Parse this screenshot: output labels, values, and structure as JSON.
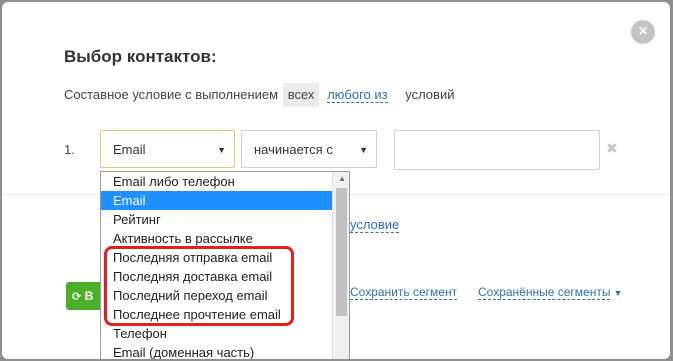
{
  "dialog": {
    "title": "Выбор контактов:",
    "close_icon": "×",
    "condition": {
      "prefix": "Составное условие с выполнением",
      "option_all": "всех",
      "option_any": "любого из",
      "suffix": "условий"
    },
    "row": {
      "number": "1.",
      "field_value": "Email",
      "operator_value": "начинается с",
      "value_text": ""
    },
    "add_condition": "условие",
    "buttons": {
      "green_label": "В",
      "save_segment": "Сохранить сегмент",
      "saved_segments": "Сохранённые сегменты"
    },
    "dropdown": {
      "items": [
        "Email либо телефон",
        "Email",
        "Рейтинг",
        "Активность в рассылке",
        "Последняя отправка email",
        "Последняя доставка email",
        "Последний переход email",
        "Последнее прочтение email",
        "Телефон",
        "Email (доменная часть)"
      ],
      "selected": "Email"
    }
  },
  "colors": {
    "accent_link": "#2e6fb7",
    "selected_bg": "#1e90ff",
    "highlight": "#e02020",
    "green_button": "#4caf2b"
  },
  "icons": {
    "close": "close-icon",
    "dropdown_caret": "caret-down-icon",
    "remove": "remove-x-icon",
    "refresh": "refresh-icon",
    "triangle": "triangle-down-icon"
  }
}
